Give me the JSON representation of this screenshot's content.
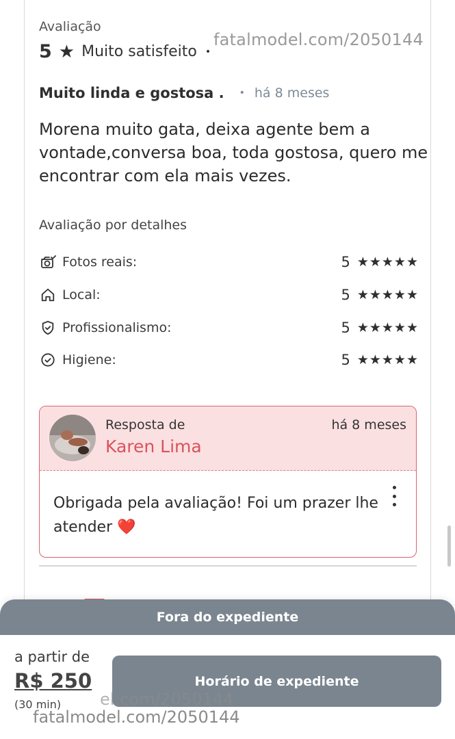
{
  "review": {
    "rating_label": "Avaliação",
    "rating_value": "5",
    "rating_text": "Muito satisfeito",
    "rating_dot": "•",
    "title": "Muito linda e gostosa .",
    "separator": "•",
    "posted": "há 8 meses",
    "body": "Morena muito gata, deixa agente bem a vontade,conversa boa, toda gostosa, quero me encontrar com ela mais vezes."
  },
  "details": {
    "label": "Avaliação por detalhes",
    "items": [
      {
        "name": "Fotos reais:",
        "score": "5",
        "stars": 5,
        "icon": "camera-check-icon"
      },
      {
        "name": "Local:",
        "score": "5",
        "stars": 5,
        "icon": "home-icon"
      },
      {
        "name": "Profissionalismo:",
        "score": "5",
        "stars": 5,
        "icon": "shield-check-icon"
      },
      {
        "name": "Higiene:",
        "score": "5",
        "stars": 5,
        "icon": "circle-check-icon"
      }
    ]
  },
  "reply": {
    "from_label": "Resposta de",
    "author": "Karen Lima",
    "posted": "há 8 meses",
    "text": "Obrigada pela avaliação! Foi um prazer lhe atender ❤️"
  },
  "bottom_sheet": {
    "banner": "Fora do expediente",
    "from_label": "a partir de",
    "price": "R$ 250",
    "duration": "(30 min)",
    "button": "Horário de expediente"
  },
  "watermark": {
    "top": "fatalmodel.com/2050144",
    "bottom_partial": "el.com/2050144",
    "bottom": "fatalmodel.com/2050144"
  },
  "colors": {
    "accent_red": "#d9535c",
    "reply_bg": "#fbe0e2",
    "sheet_gray": "#7a858f"
  }
}
